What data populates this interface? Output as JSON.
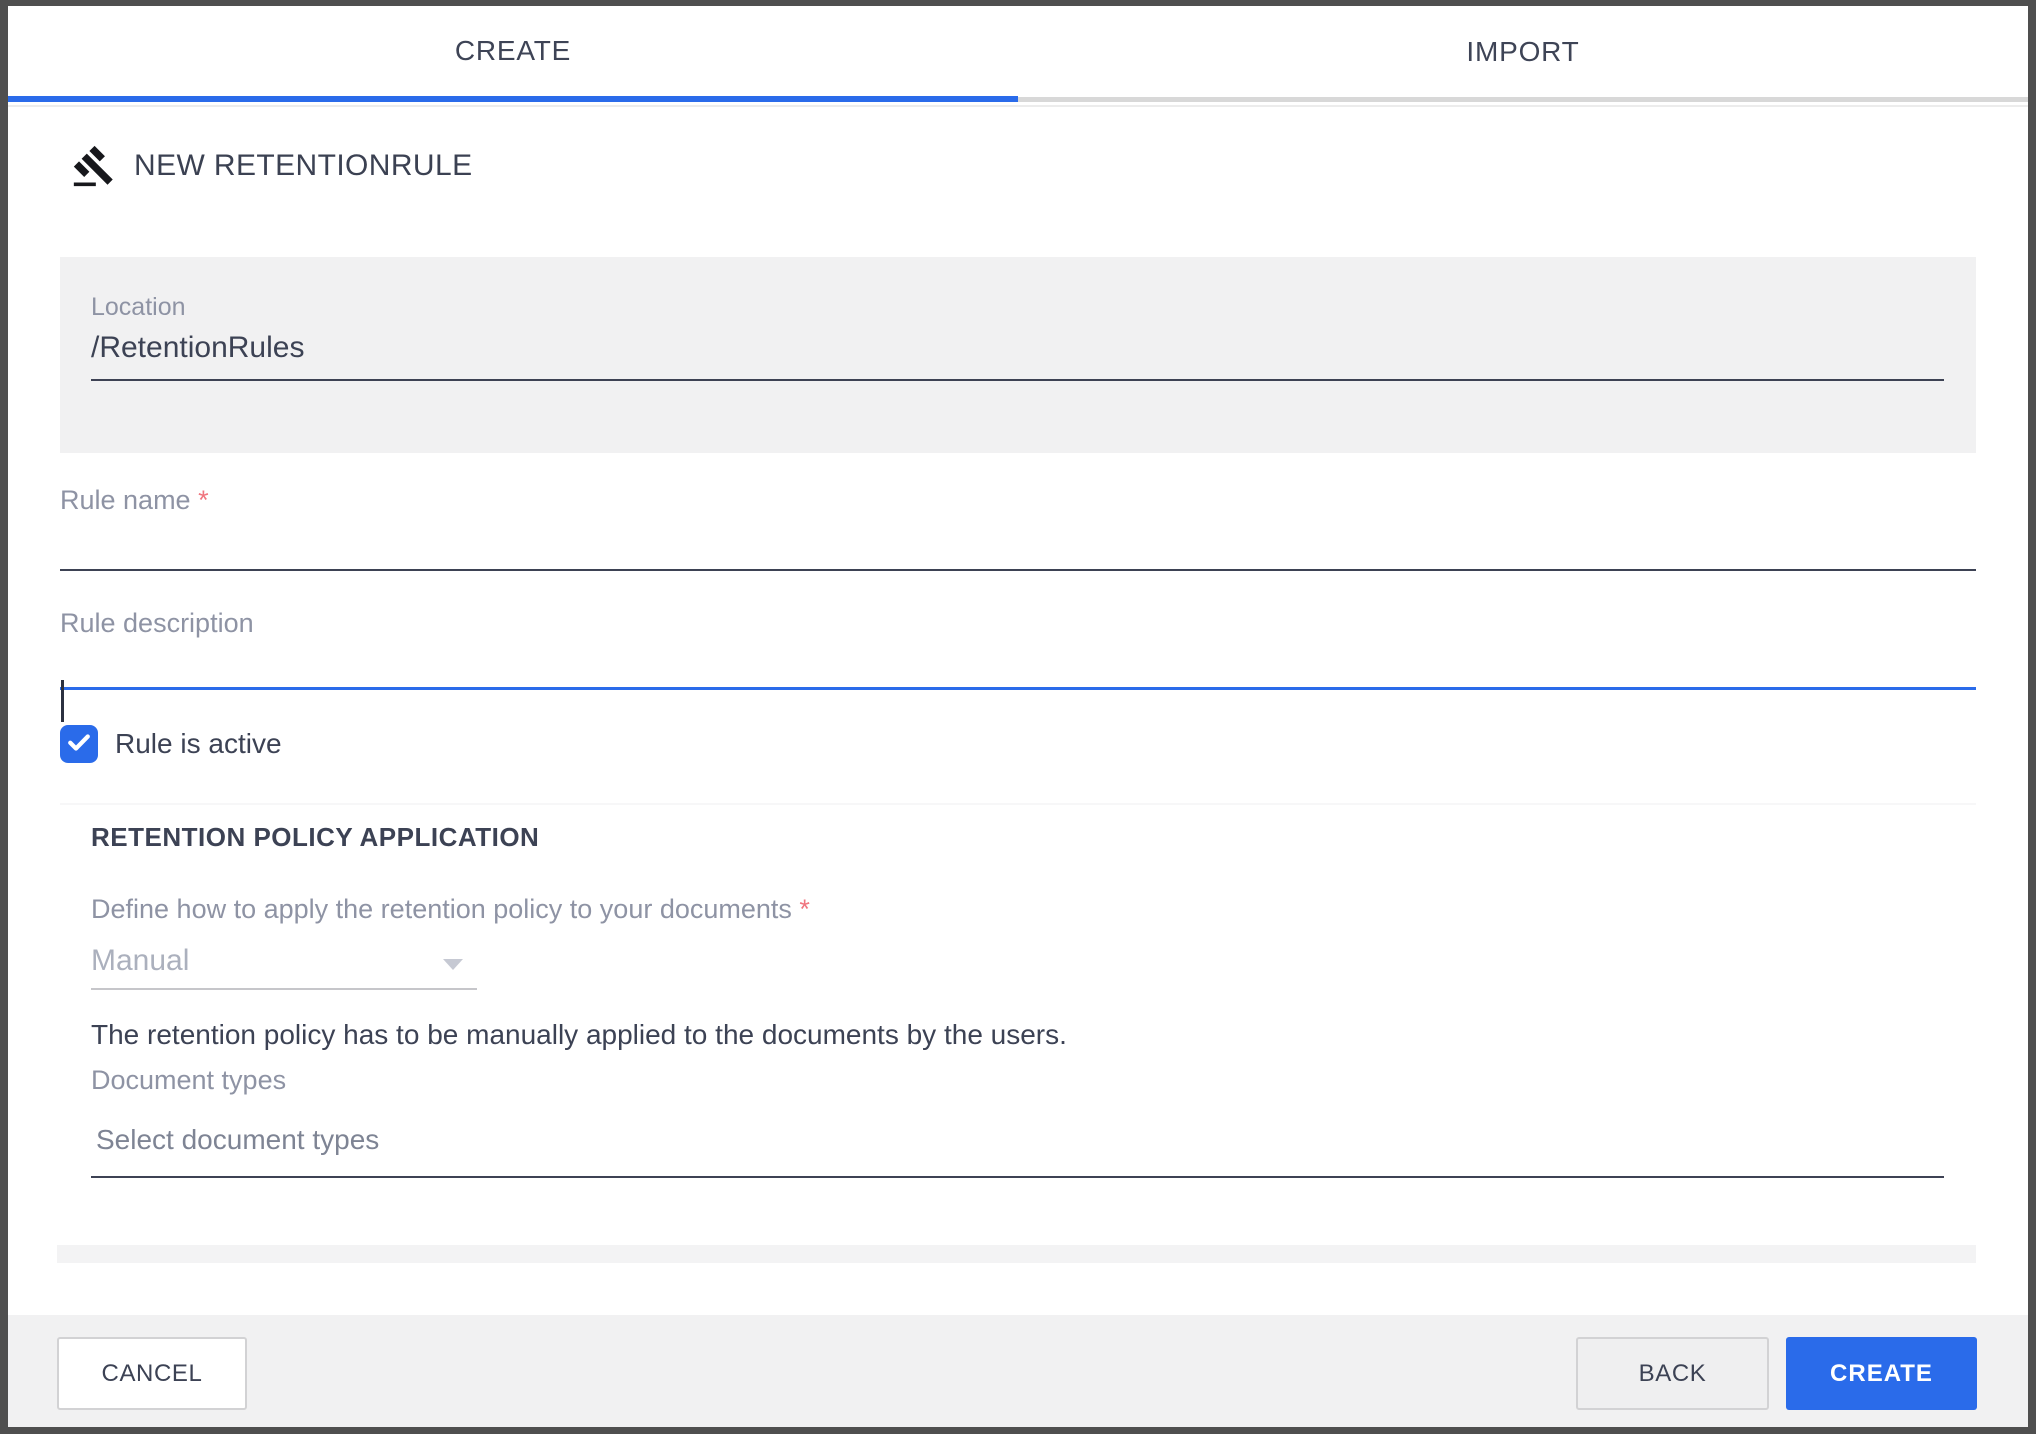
{
  "dialog": {
    "tabs": [
      {
        "label": "CREATE",
        "active": true
      },
      {
        "label": "IMPORT",
        "active": false
      }
    ],
    "title": "NEW RETENTIONRULE"
  },
  "form": {
    "location": {
      "label": "Location",
      "value": "/RetentionRules"
    },
    "rule_name": {
      "label": "Rule name",
      "required_marker": "*",
      "value": ""
    },
    "rule_description": {
      "label": "Rule description",
      "value": ""
    },
    "rule_is_active": {
      "label": "Rule is active",
      "checked": true
    },
    "retention_policy": {
      "section_title": "RETENTION POLICY APPLICATION",
      "apply_label": "Define how to apply the retention policy to your documents",
      "required_marker": "*",
      "apply_value": "Manual",
      "apply_disabled": true,
      "apply_help": "The retention policy has to be manually applied to the documents by the users.",
      "document_types_label": "Document types",
      "document_types_placeholder": "Select document types"
    }
  },
  "footer": {
    "cancel_label": "CANCEL",
    "back_label": "BACK",
    "create_label": "CREATE"
  },
  "colors": {
    "accent_blue": "#2a6bea",
    "required_red": "#f0757f",
    "text_dark": "#3c4254",
    "label_gray": "#8e93a4",
    "disabled_text": "#abb0bd"
  }
}
